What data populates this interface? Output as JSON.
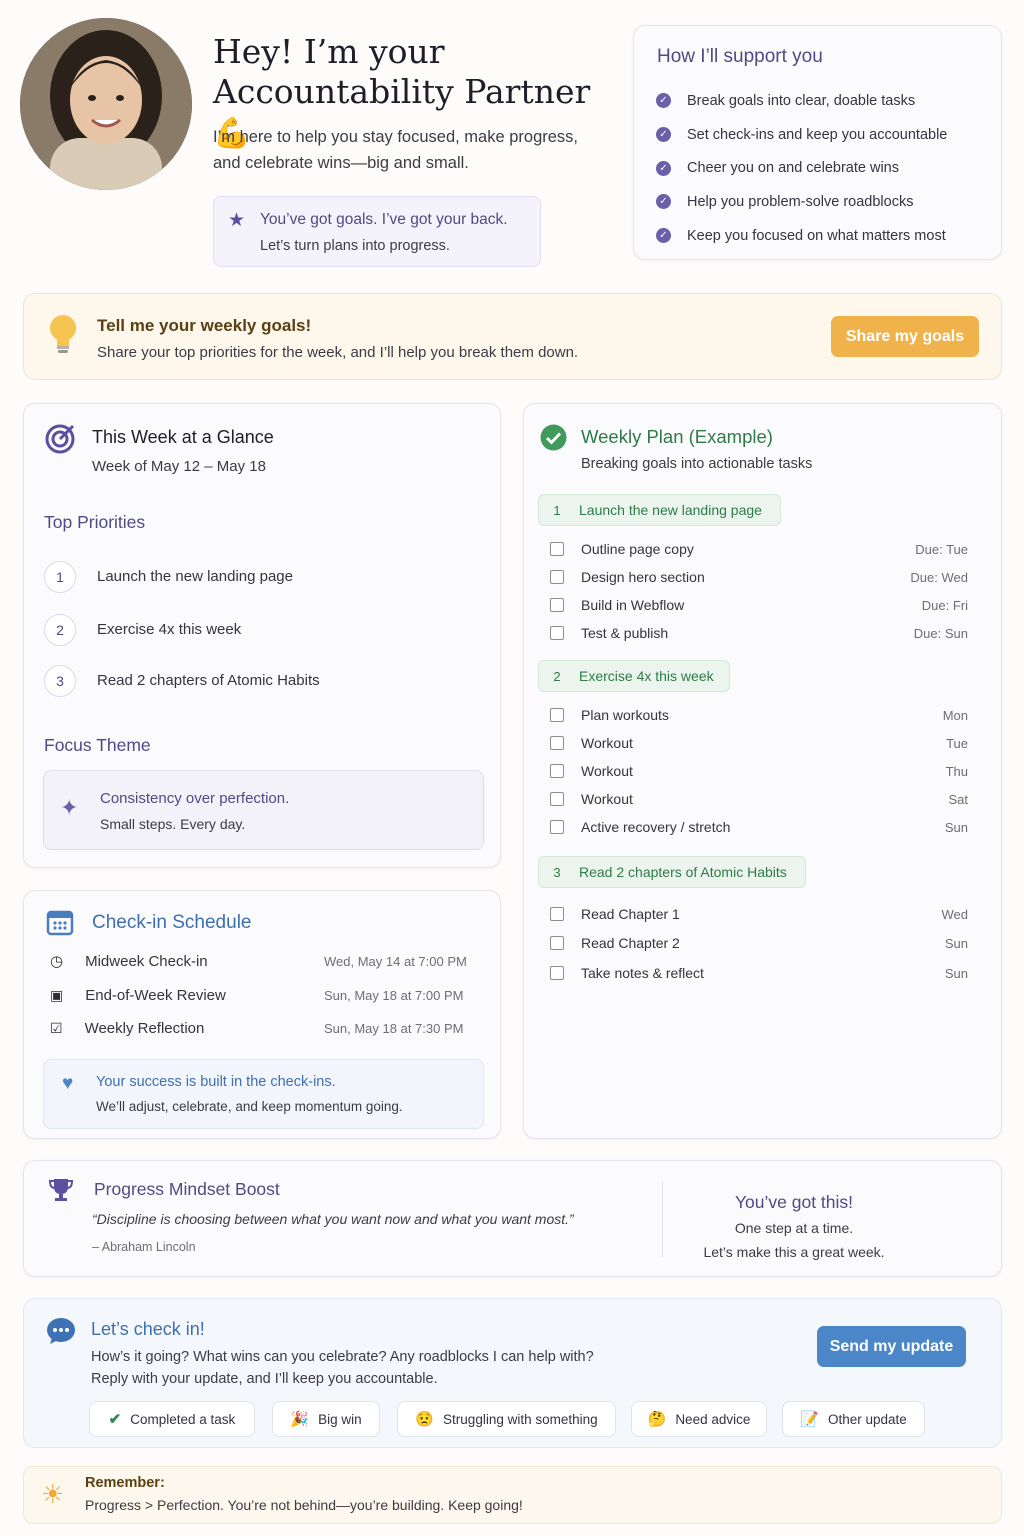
{
  "hero": {
    "title_line1": "Hey! I’m your",
    "title_line2": "Accountability Partner",
    "title_emoji": "💪",
    "subtitle": "I’m here to help you stay focused, make progress, and celebrate wins—big and small.",
    "quote_title": "You’ve got goals. I’ve got your back.",
    "quote_sub": "Let’s turn plans into progress."
  },
  "support": {
    "title": "How I’ll support you",
    "items": [
      "Break goals into clear, doable tasks",
      "Set check-ins and keep you accountable",
      "Cheer you on and celebrate wins",
      "Help you problem-solve roadblocks",
      "Keep you focused on what matters most"
    ]
  },
  "goals_banner": {
    "title": "Tell me your weekly goals!",
    "text": "Share your top priorities for the week, and I’ll help you break them down.",
    "button": "Share my goals"
  },
  "glance": {
    "title": "This Week at a Glance",
    "dates": "Week of May 12 – May 18",
    "priorities_title": "Top Priorities",
    "priorities": [
      {
        "num": "1",
        "text": "Launch the new landing page"
      },
      {
        "num": "2",
        "text": "Exercise 4x this week"
      },
      {
        "num": "3",
        "text": "Read 2 chapters of Atomic Habits"
      }
    ],
    "focus_title": "Focus Theme",
    "focus_main": "Consistency over perfection.",
    "focus_sub": "Small steps. Every day."
  },
  "schedule": {
    "title": "Check-in Schedule",
    "rows": [
      {
        "label": "Midweek Check-in",
        "when": "Wed, May 14 at 7:00 PM"
      },
      {
        "label": "End-of-Week Review",
        "when": "Sun, May 18 at 7:00 PM"
      },
      {
        "label": "Weekly Reflection",
        "when": "Sun, May 18 at 7:30 PM"
      }
    ],
    "success_title": "Your success is built in the check-ins.",
    "success_sub": "We’ll adjust, celebrate, and keep momentum going."
  },
  "plan": {
    "title": "Weekly Plan (Example)",
    "subtitle": "Breaking goals into actionable tasks",
    "groups": [
      {
        "num": "1",
        "name": "Launch the new landing page",
        "tasks": [
          {
            "t": "Outline page copy",
            "d": "Due: Tue"
          },
          {
            "t": "Design hero section",
            "d": "Due: Wed"
          },
          {
            "t": "Build in Webflow",
            "d": "Due: Fri"
          },
          {
            "t": "Test & publish",
            "d": "Due: Sun"
          }
        ]
      },
      {
        "num": "2",
        "name": "Exercise 4x this week",
        "tasks": [
          {
            "t": "Plan workouts",
            "d": "Mon"
          },
          {
            "t": "Workout",
            "d": "Tue"
          },
          {
            "t": "Workout",
            "d": "Thu"
          },
          {
            "t": "Workout",
            "d": "Sat"
          },
          {
            "t": "Active recovery / stretch",
            "d": "Sun"
          }
        ]
      },
      {
        "num": "3",
        "name": "Read 2 chapters of Atomic Habits",
        "tasks": [
          {
            "t": "Read Chapter 1",
            "d": "Wed"
          },
          {
            "t": "Read Chapter 2",
            "d": "Sun"
          },
          {
            "t": "Take notes & reflect",
            "d": "Sun"
          }
        ]
      }
    ]
  },
  "mindset": {
    "title": "Progress Mindset Boost",
    "quote": "“Discipline is choosing between what you want now and what you want most.”",
    "author": "– Abraham Lincoln",
    "right_title": "You’ve got this!",
    "right_line1": "One step at a time.",
    "right_line2": "Let’s make this a great week."
  },
  "checkin": {
    "title": "Let’s check in!",
    "line1": "How’s it going? What wins can you celebrate? Any roadblocks I can help with?",
    "line2": "Reply with your update, and I’ll keep you accountable.",
    "button": "Send my update",
    "chips": [
      {
        "icon": "✔",
        "label": "Completed a task"
      },
      {
        "icon": "🎉",
        "label": "Big win"
      },
      {
        "icon": "😟",
        "label": "Struggling with something"
      },
      {
        "icon": "🤔",
        "label": "Need advice"
      },
      {
        "icon": "📝",
        "label": "Other update"
      }
    ]
  },
  "remember": {
    "title": "Remember:",
    "text": "Progress > Perfection. You’re not behind—you’re building. Keep going!"
  },
  "colors": {
    "accent_purple": "#4f4a85",
    "accent_green": "#2f7a47",
    "accent_blue": "#4a86c8",
    "accent_amber": "#f0b24a"
  }
}
